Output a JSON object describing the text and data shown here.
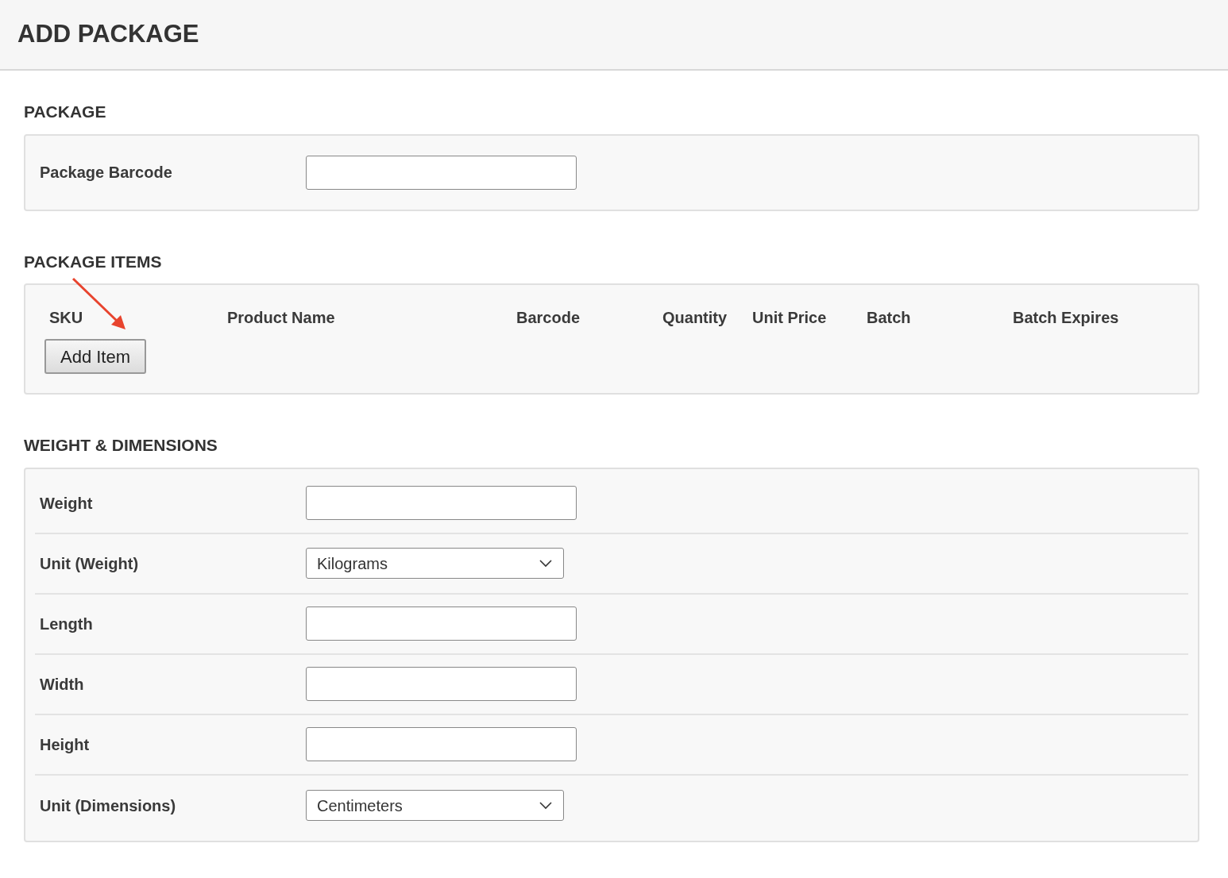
{
  "page_title": "ADD PACKAGE",
  "sections": [
    {
      "title": "PACKAGE",
      "kind": "form",
      "fields": [
        {
          "label": "Package Barcode",
          "kind": "text"
        }
      ]
    },
    {
      "title": "PACKAGE ITEMS",
      "kind": "table",
      "columns": [
        "SKU",
        "Product Name",
        "Barcode",
        "Quantity",
        "Unit Price",
        "Batch",
        "Batch Expires"
      ],
      "button": "Add Item"
    },
    {
      "title": "WEIGHT & DIMENSIONS",
      "kind": "form",
      "fields": [
        {
          "label": "Weight",
          "kind": "text"
        },
        {
          "label": "Unit (Weight)",
          "kind": "select",
          "value": "Kilograms"
        },
        {
          "label": "Length",
          "kind": "text"
        },
        {
          "label": "Width",
          "kind": "text"
        },
        {
          "label": "Height",
          "kind": "text"
        },
        {
          "label": "Unit (Dimensions)",
          "kind": "select",
          "value": "Centimeters"
        }
      ]
    }
  ]
}
